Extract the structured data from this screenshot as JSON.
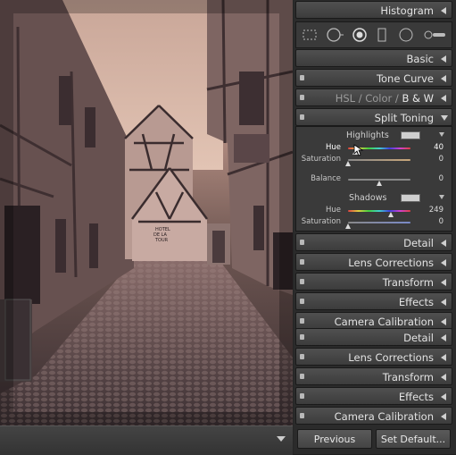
{
  "panels": {
    "histogram": "Histogram",
    "basic": "Basic",
    "tone_curve": "Tone Curve",
    "hsl": [
      "HSL",
      "Color",
      "B & W"
    ],
    "hsl_sep": "/",
    "split_toning": "Split Toning",
    "detail": "Detail",
    "lens_corrections": "Lens Corrections",
    "transform": "Transform",
    "effects": "Effects",
    "camera_calibration": "Camera Calibration"
  },
  "split_toning": {
    "highlights_title": "Highlights",
    "highlights_hue_label": "Hue",
    "highlights_hue_value": "40",
    "highlights_sat_label": "Saturation",
    "highlights_sat_value": "0",
    "balance_label": "Balance",
    "balance_value": "0",
    "shadows_title": "Shadows",
    "shadows_hue_label": "Hue",
    "shadows_hue_value": "249",
    "shadows_sat_label": "Saturation",
    "shadows_sat_value": "0"
  },
  "photo": {
    "sign_text": [
      "HOTEL",
      "DE LA",
      "TOUR"
    ],
    "sign2_text": [
      "HOTEL",
      "DE LA",
      "TOUR"
    ]
  },
  "buttons": {
    "previous": "Previous",
    "set_default": "Set Default..."
  },
  "slider_levels": {
    "highlights_hue": 0.11,
    "highlights_sat": 0.0,
    "balance": 0.5,
    "shadows_hue": 0.69,
    "shadows_sat": 0.0
  }
}
